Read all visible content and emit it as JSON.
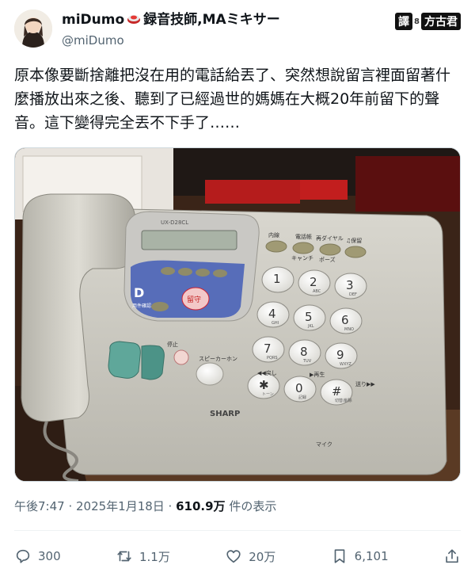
{
  "tweet": {
    "display_name": "miDumo",
    "display_name_suffix": "録音技師,MAミキサー",
    "handle": "@miDumo",
    "translator_label_1": "譯",
    "translator_sep": "8",
    "translator_label_2": "方古君",
    "text": "原本像要斷捨離把沒在用的電話給丟了、突然想說留言裡面留著什麼播放出來之後、聽到了已經過世的媽媽在大概20年前留下的聲音。這下變得完全丟不下手了……"
  },
  "photo": {
    "model": "UX-D28CL",
    "brand": "SHARP",
    "func_keys": [
      "内線",
      "電話帳",
      "再ダイヤル",
      "♫保留"
    ],
    "func_sub": [
      "キャンチ",
      "ポーズ"
    ],
    "keys": [
      {
        "num": "1",
        "sub": ""
      },
      {
        "num": "2",
        "sub": "ABC"
      },
      {
        "num": "3",
        "sub": "DEF"
      },
      {
        "num": "4",
        "sub": "GHI"
      },
      {
        "num": "5",
        "sub": "JKL"
      },
      {
        "num": "6",
        "sub": "MNO"
      },
      {
        "num": "7",
        "sub": "PQRS"
      },
      {
        "num": "8",
        "sub": "TUV"
      },
      {
        "num": "9",
        "sub": "WXYZ"
      },
      {
        "num": "✱",
        "sub": "トーン"
      },
      {
        "num": "0",
        "sub": "記録"
      },
      {
        "num": "#",
        "sub": "切替/削除"
      }
    ],
    "labels": {
      "stop": "停止",
      "speaker": "スピーカーホン",
      "rewind": "◀◀戻し",
      "play": "▶再生",
      "forward": "送り▶▶",
      "mic": "マイク",
      "rusu": "留守",
      "d_label": "D",
      "d_sub": "用件確認"
    }
  },
  "meta": {
    "time": "午後7:47 · 2025年1月18日 · ",
    "views": "610.9万",
    "views_label": " 件の表示"
  },
  "actions": {
    "replies": "300",
    "retweets": "1.1万",
    "likes": "20万",
    "bookmarks": "6,101"
  },
  "colors": {
    "text": "#0f1419",
    "secondary": "#536471",
    "divider": "#eff3f4"
  }
}
